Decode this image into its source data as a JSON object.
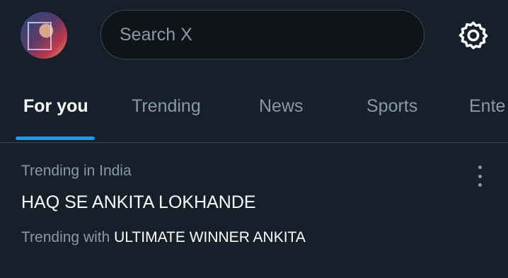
{
  "header": {
    "search_placeholder": "Search X",
    "avatar_icon": "profile-avatar",
    "settings_icon": "gear-icon"
  },
  "tabs": [
    {
      "label": "For you",
      "active": true
    },
    {
      "label": "Trending",
      "active": false
    },
    {
      "label": "News",
      "active": false
    },
    {
      "label": "Sports",
      "active": false
    },
    {
      "label": "Ente",
      "active": false
    }
  ],
  "trend": {
    "context": "Trending in India",
    "title": "HAQ SE ANKITA LOKHANDE",
    "with_prefix": "Trending with",
    "with_name": "ULTIMATE WINNER ANKITA",
    "more_icon": "more-vertical-icon"
  },
  "colors": {
    "background": "#15202b",
    "accent": "#1d9bf0",
    "muted_text": "#8b98a5",
    "border": "#38444d"
  }
}
